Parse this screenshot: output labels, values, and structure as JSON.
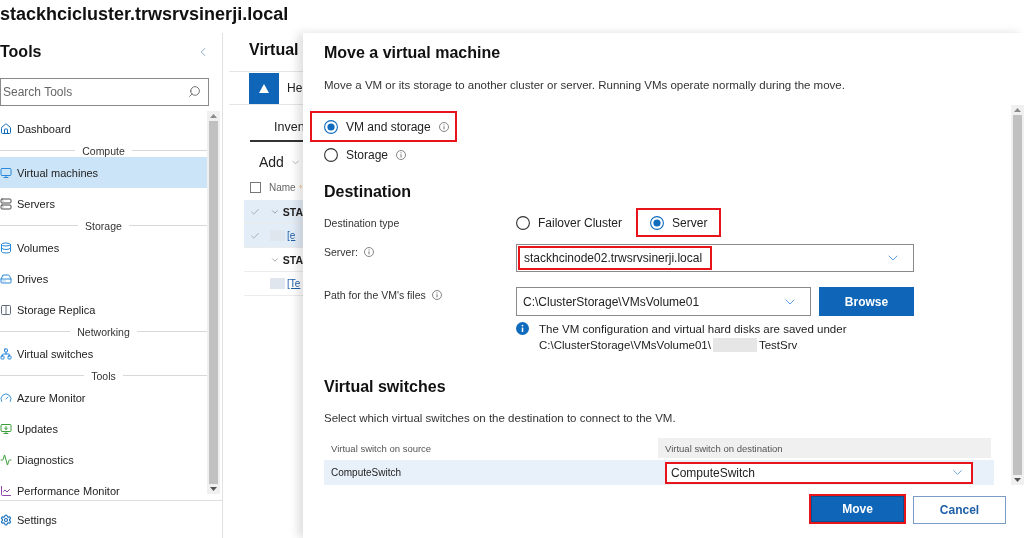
{
  "title": "stackhcicluster.trwsrvsinerji.local",
  "sidebar": {
    "title": "Tools",
    "search": {
      "placeholder": "Search Tools"
    },
    "items": [
      {
        "kind": "link",
        "label": "Dashboard",
        "selected": false
      },
      {
        "kind": "divider",
        "label": "Compute"
      },
      {
        "kind": "link",
        "label": "Virtual machines",
        "selected": true
      },
      {
        "kind": "link",
        "label": "Servers",
        "selected": false
      },
      {
        "kind": "divider",
        "label": "Storage"
      },
      {
        "kind": "link",
        "label": "Volumes",
        "selected": false
      },
      {
        "kind": "link",
        "label": "Drives",
        "selected": false
      },
      {
        "kind": "link",
        "label": "Storage Replica",
        "selected": false
      },
      {
        "kind": "divider",
        "label": "Networking"
      },
      {
        "kind": "link",
        "label": "Virtual switches",
        "selected": false
      },
      {
        "kind": "divider",
        "label": "Tools"
      },
      {
        "kind": "link",
        "label": "Azure Monitor",
        "selected": false
      },
      {
        "kind": "link",
        "label": "Updates",
        "selected": false
      },
      {
        "kind": "link",
        "label": "Diagnostics",
        "selected": false
      },
      {
        "kind": "link",
        "label": "Performance Monitor",
        "selected": false
      }
    ],
    "settings": {
      "label": "Settings"
    }
  },
  "vm_panel": {
    "title": "Virtual",
    "banner": {
      "text": "He"
    },
    "tabs": [
      {
        "label": "Inven",
        "selected": true
      }
    ],
    "add_button": "Add",
    "table": {
      "select_all": {
        "checked": false
      },
      "columns": [
        "Name"
      ],
      "rows": [
        {
          "label": "STA",
          "expanded": true,
          "selected": true,
          "children": [
            {
              "label": "[e",
              "redacted": true,
              "selected": true
            }
          ]
        },
        {
          "label": "STA",
          "expanded": true,
          "selected": false,
          "children": [
            {
              "label": "[Te",
              "redacted": true,
              "selected": false
            }
          ]
        }
      ]
    }
  },
  "dialog": {
    "title": "Move a virtual machine",
    "description": "Move a VM or its storage to another cluster or server. Running VMs operate normally during the move.",
    "move_options": [
      {
        "label": "VM and storage",
        "selected": true,
        "highlighted": true
      },
      {
        "label": "Storage",
        "selected": false,
        "highlighted": false
      }
    ],
    "destination": {
      "heading": "Destination",
      "type_label": "Destination type",
      "types": [
        {
          "label": "Failover Cluster",
          "selected": false,
          "highlighted": false
        },
        {
          "label": "Server",
          "selected": true,
          "highlighted": true
        }
      ],
      "server": {
        "label": "Server:",
        "value": "stackhcinode02.trwsrvsinerji.local",
        "highlighted": true
      },
      "path": {
        "label": "Path for the VM's files",
        "value": "C:\\ClusterStorage\\VMsVolume01",
        "browse": "Browse"
      },
      "note": {
        "text": "The VM configuration and virtual hard disks are saved under",
        "path_start": "C:\\ClusterStorage\\VMsVolume01\\",
        "redacted": true,
        "path_end": "TestSrv"
      }
    },
    "switches": {
      "heading": "Virtual switches",
      "description": "Select which virtual switches on the destination to connect to the VM.",
      "columns": [
        "Virtual switch on source",
        "Virtual switch on destination"
      ],
      "rows": [
        {
          "source": "ComputeSwitch",
          "destination": "ComputeSwitch",
          "highlighted": true
        }
      ]
    },
    "buttons": [
      {
        "label": "Move",
        "kind": "primary",
        "highlighted": true
      },
      {
        "label": "Cancel",
        "kind": "secondary",
        "highlighted": false
      }
    ]
  }
}
